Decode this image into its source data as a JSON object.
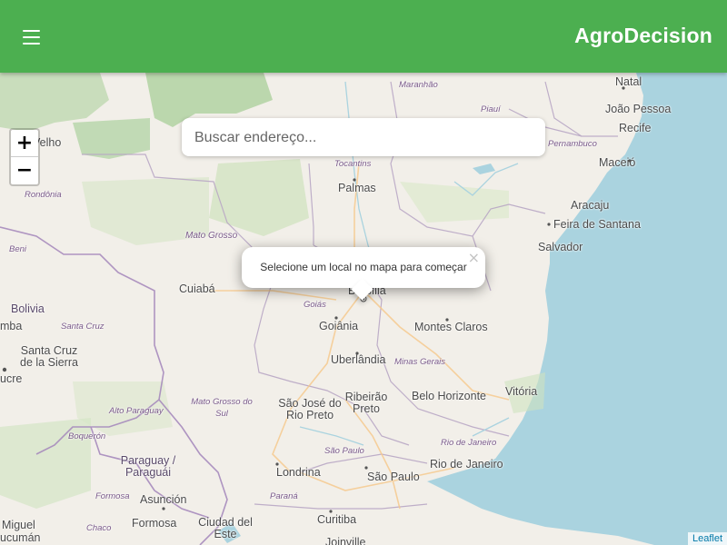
{
  "header": {
    "title": "AgroDecision",
    "menu_icon": "hamburger-menu-icon",
    "background": "#4caf50"
  },
  "search": {
    "placeholder": "Buscar endereço..."
  },
  "zoom": {
    "in_label": "+",
    "out_label": "−"
  },
  "popup": {
    "text": "Selecione um local no mapa para começar",
    "close_label": "×"
  },
  "attribution": "Leaflet",
  "map": {
    "states": [
      "Maranhão",
      "Piauí",
      "Pernambuco",
      "Tocantins",
      "Rondônia",
      "Mato Grosso",
      "Goiás",
      "Minas Gerais",
      "Mato Grosso do Sul",
      "Alto Paraguay",
      "Boquerón",
      "São Paulo",
      "Rio de Janeiro",
      "Paraná",
      "Formosa",
      "Chaco",
      "Santa Cruz",
      "Beni"
    ],
    "cities": [
      "Natal",
      "João Pessoa",
      "Recife",
      "Maceió",
      "Aracaju",
      "Feira de Santana",
      "Salvador",
      "Palmas",
      "Cuiabá",
      "Brasília",
      "Goiânia",
      "Montes Claros",
      "Uberlândia",
      "Vitória",
      "Ribeirão Preto",
      "Belo Horizonte",
      "São José do Rio Preto",
      "Londrina",
      "São Paulo",
      "Rio de Janeiro",
      "Curitiba",
      "Joinville",
      "Asunción",
      "Formosa",
      "Ciudad del Este",
      "Santa Cruz de la Sierra",
      "Miguel",
      "ucumán",
      "ucre",
      "mba",
      "Velho"
    ],
    "countries": [
      "Bolivia",
      "Paraguay / Paraguái"
    ]
  }
}
